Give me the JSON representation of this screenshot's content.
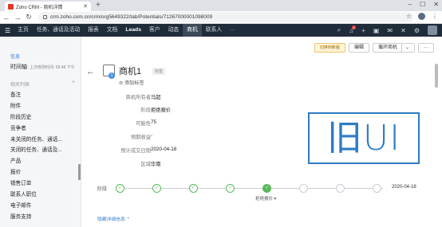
{
  "browser": {
    "tab_title": "Zoho CRM - 商机详情",
    "url": "crm.zoho.com.cn/crm/org5649322/tab/Potentials/712670000010980​09",
    "new_tab_icon": "+"
  },
  "crm_nav": {
    "items": [
      "主页",
      "任务、通话及活动",
      "报表",
      "文档",
      "Leads",
      "客户",
      "动态",
      "商机",
      "联系人",
      "···"
    ],
    "active": "商机",
    "notification_count": "1"
  },
  "sidebar": {
    "info_label": "信息",
    "timeline_label": "时间轴",
    "timeline_note": "上次修改时间: 09:48 下午",
    "related_header": "相关列表",
    "items": [
      "备注",
      "附件",
      "阶段历史",
      "竞争者",
      "未关闭的任务、通话...",
      "关闭的任务、通话及...",
      "产品",
      "报价",
      "销售订单",
      "联系人职位",
      "电子邮件",
      "服务支持"
    ]
  },
  "record": {
    "title": "商机1",
    "tag_badge": "标签",
    "add_tag": "添加标签",
    "icon_badge": "1"
  },
  "buttons": {
    "convert": "切换到新版",
    "edit": "编辑",
    "clone": "循环商机",
    "more": "···"
  },
  "fields": [
    {
      "label": "商机所有者",
      "value": "马超"
    },
    {
      "label": "阶段",
      "value": "拒绝报价"
    },
    {
      "label": "可能性",
      "value": "75"
    },
    {
      "label": "预期收益",
      "value": "-"
    },
    {
      "label": "预计成交日期",
      "value": "2020-04-18"
    },
    {
      "label": "区域",
      "value": "华南"
    }
  ],
  "stage_bar": {
    "label": "阶段",
    "current_name": "拒绝报价 ▾",
    "date": "2020-04-18",
    "completed": 5,
    "total": 8
  },
  "more_details": "隐藏详细信息 ⌃",
  "overlay_text": "旧UI",
  "colors": {
    "nav_bg": "#1f2c3a",
    "accent_blue": "#2e7cc4",
    "stage_green": "#5cb85c"
  }
}
